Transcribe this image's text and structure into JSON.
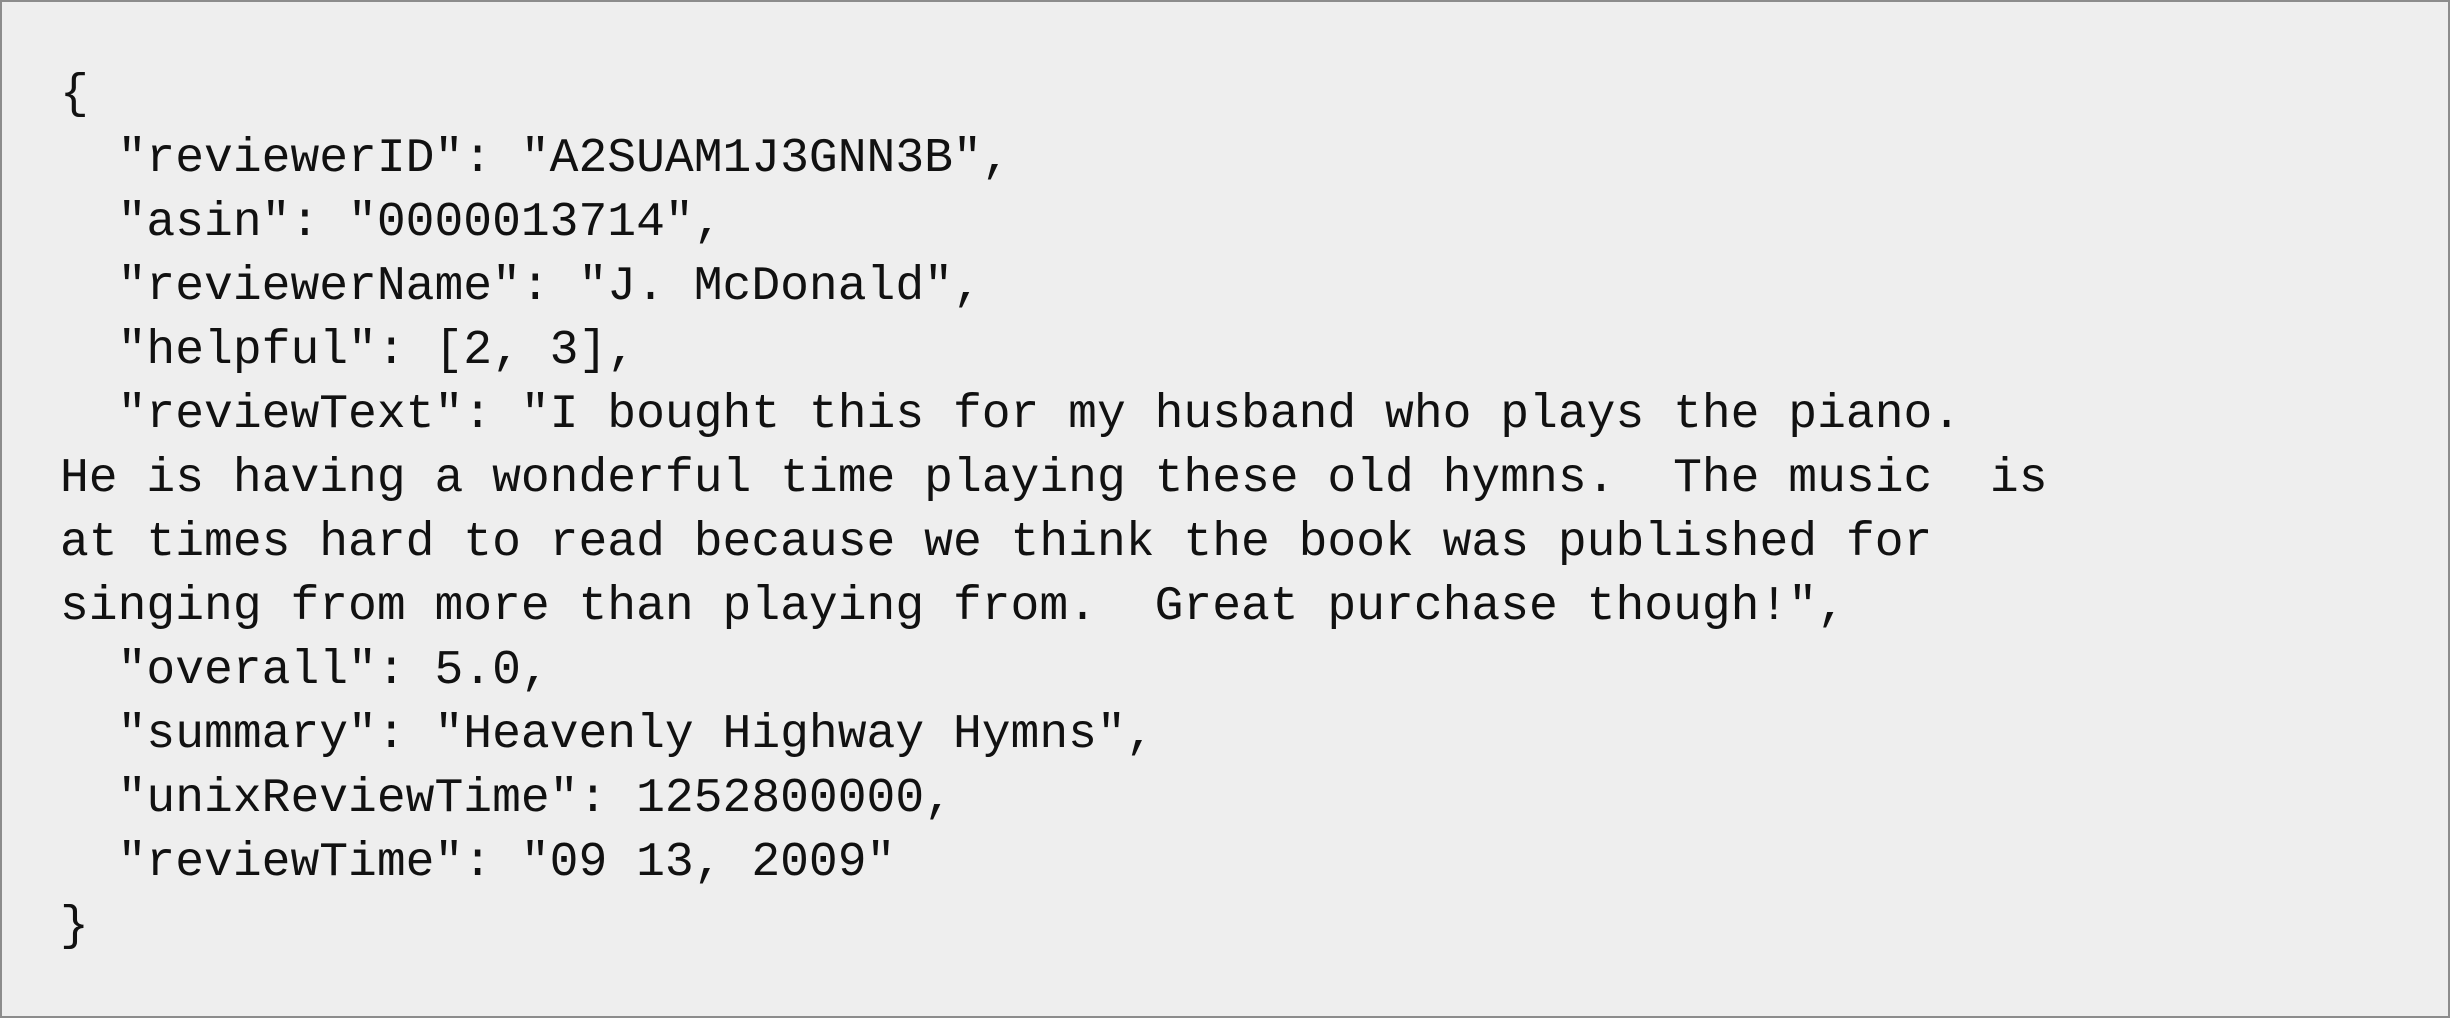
{
  "document": {
    "lines": [
      "{",
      "  \"reviewerID\": \"A2SUAM1J3GNN3B\",",
      "  \"asin\": \"0000013714\",",
      "  \"reviewerName\": \"J. McDonald\",",
      "  \"helpful\": [2, 3],",
      "  \"reviewText\": \"I bought this for my husband who plays the piano.",
      "He is having a wonderful time playing these old hymns.  The music  is",
      "at times hard to read because we think the book was published for",
      "singing from more than playing from.  Great purchase though!\",",
      "  \"overall\": 5.0,",
      "  \"summary\": \"Heavenly Highway Hymns\",",
      "  \"unixReviewTime\": 1252800000,",
      "  \"reviewTime\": \"09 13, 2009\"",
      "}"
    ]
  }
}
